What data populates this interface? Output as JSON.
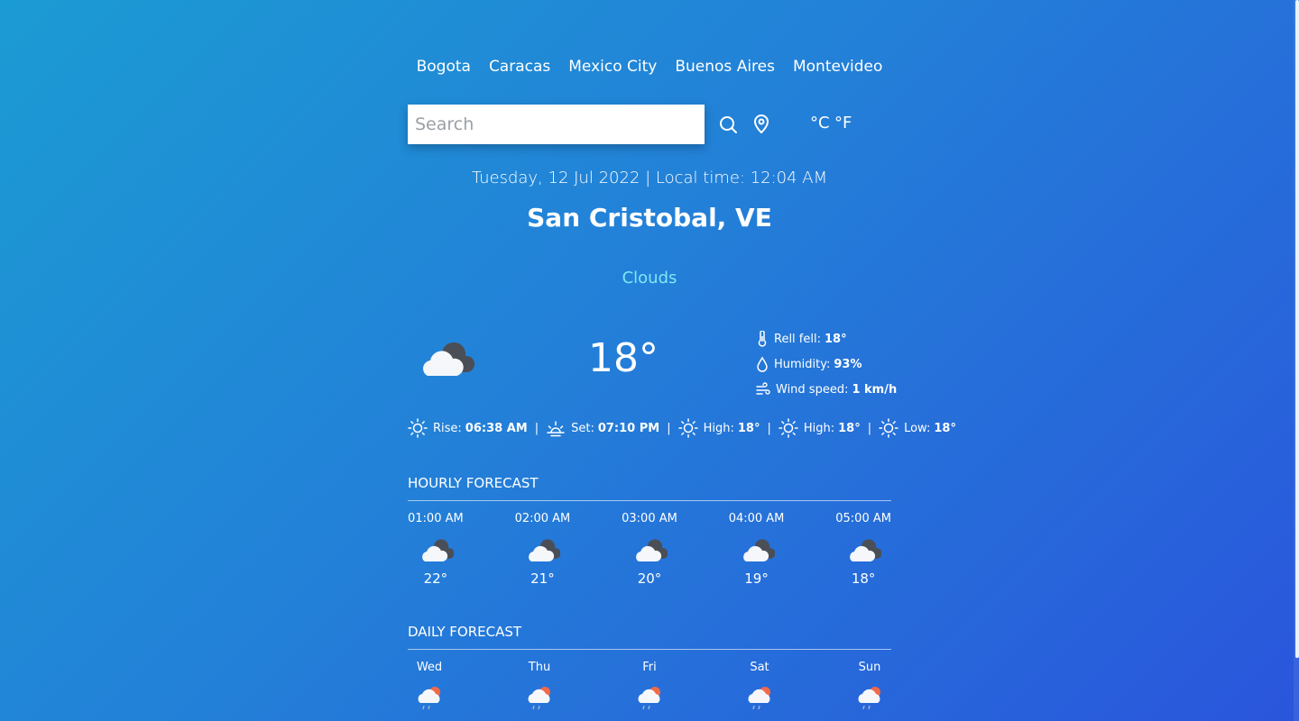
{
  "cities": [
    "Bogota",
    "Caracas",
    "Mexico City",
    "Buenos Aires",
    "Montevideo"
  ],
  "search": {
    "placeholder": "Search",
    "value": ""
  },
  "units": {
    "celsius": "°C",
    "fahrenheit": "°F"
  },
  "datetime": "Tuesday, 12 Jul 2022 | Local time: 12:04 AM",
  "location": "San Cristobal, VE",
  "condition": "Clouds",
  "current": {
    "temp": "18°",
    "icon": "cloudy-night-icon",
    "details": [
      {
        "label": "Rell fell:",
        "value": "18°",
        "icon": "thermometer-icon"
      },
      {
        "label": "Humidity:",
        "value": "93%",
        "icon": "droplet-icon"
      },
      {
        "label": "Wind speed:",
        "value": "1 km/h",
        "icon": "wind-icon"
      }
    ]
  },
  "sun": [
    {
      "label": "Rise:",
      "value": "06:38 AM",
      "icon": "sun-icon"
    },
    {
      "label": "Set:",
      "value": "07:10 PM",
      "icon": "sunset-icon"
    },
    {
      "label": "High:",
      "value": "18°",
      "icon": "sun-icon"
    },
    {
      "label": "High:",
      "value": "18°",
      "icon": "sun-icon"
    },
    {
      "label": "Low:",
      "value": "18°",
      "icon": "sun-icon"
    }
  ],
  "hourly": {
    "title": "HOURLY FORECAST",
    "items": [
      {
        "time": "01:00 AM",
        "temp": "22°"
      },
      {
        "time": "02:00 AM",
        "temp": "21°"
      },
      {
        "time": "03:00 AM",
        "temp": "20°"
      },
      {
        "time": "04:00 AM",
        "temp": "19°"
      },
      {
        "time": "05:00 AM",
        "temp": "18°"
      }
    ]
  },
  "daily": {
    "title": "DAILY FORECAST",
    "items": [
      {
        "day": "Wed"
      },
      {
        "day": "Thu"
      },
      {
        "day": "Fri"
      },
      {
        "day": "Sat"
      },
      {
        "day": "Sun"
      }
    ]
  },
  "colors": {
    "accent": "#7fe7f2",
    "bg_start": "#1b9bd3",
    "bg_end": "#2a55dc"
  }
}
